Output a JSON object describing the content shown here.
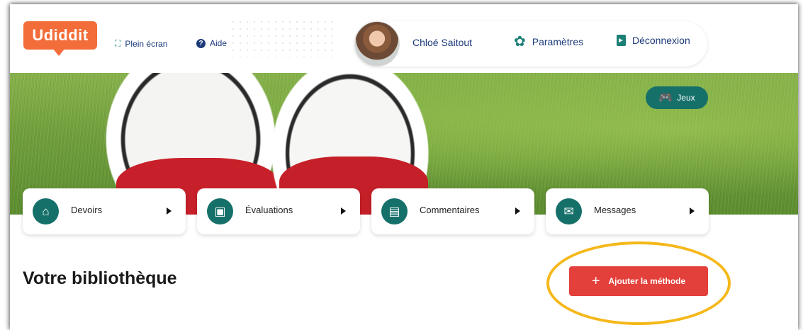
{
  "header": {
    "logo_text": "Udiddit",
    "fullscreen_label": "Plein écran",
    "help_label": "Aide"
  },
  "user": {
    "name": "Chloé Saitout",
    "settings_label": "Paramètres",
    "logout_label": "Déconnexion"
  },
  "banner": {
    "games_label": "Jeux"
  },
  "nav": {
    "items": [
      {
        "label": "Devoirs",
        "icon": "house-icon"
      },
      {
        "label": "Évaluations",
        "icon": "evaluation-icon"
      },
      {
        "label": "Commentaires",
        "icon": "comments-icon"
      },
      {
        "label": "Messages",
        "icon": "envelope-icon"
      }
    ]
  },
  "main": {
    "title": "Votre bibliothèque",
    "add_method_label": "Ajouter la méthode"
  },
  "colors": {
    "brand": "#f26d39",
    "teal": "#16706a",
    "button_red": "#e3403b",
    "highlight": "#f5b81a",
    "link_blue": "#1b3a7a"
  }
}
